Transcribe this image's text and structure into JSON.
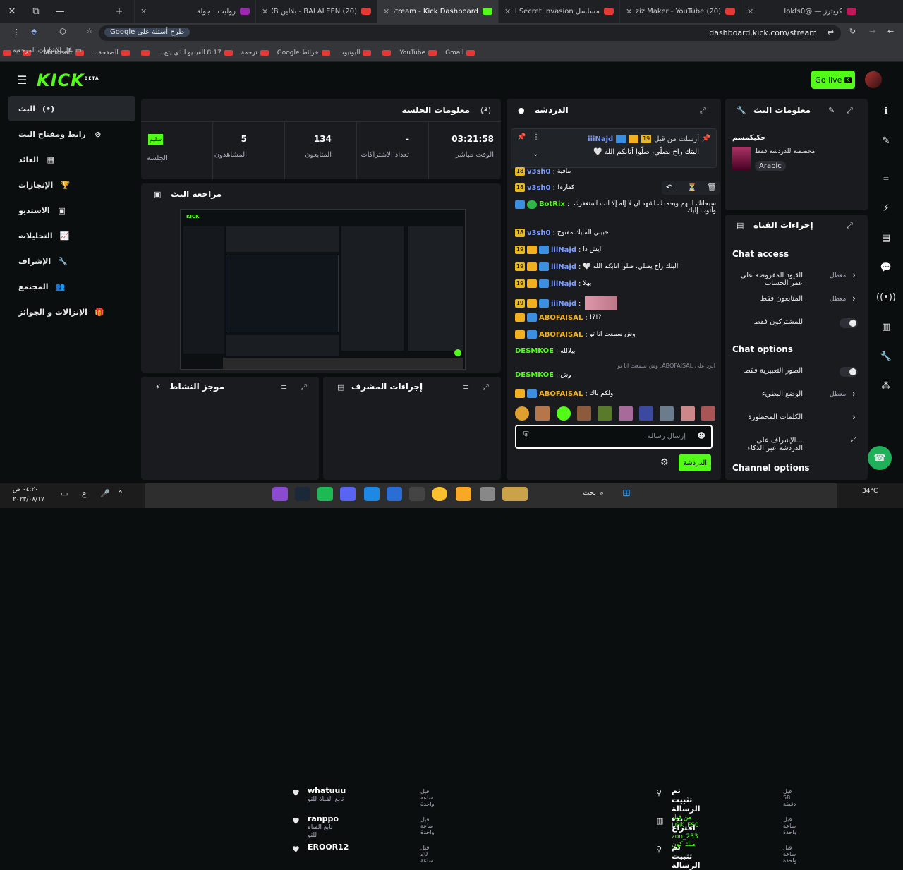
{
  "browser": {
    "tabs": [
      {
        "label": "كريترز — @lokfs0",
        "fav": "#c2185b"
      },
      {
        "label": "(20) Aziz Maker - YouTube",
        "fav": "#e53935"
      },
      {
        "label": "مسلسل Secret Invasion الموسم",
        "fav": "#e53935"
      },
      {
        "label": "Stream - Kick Dashboard",
        "fav": "#53fc18"
      },
      {
        "label": "(20) BALALEEN - بلالين BLVXB",
        "fav": "#e53935"
      },
      {
        "label": "رولیت | جولة",
        "fav": "#9c27b0"
      }
    ],
    "url": "dashboard.kick.com/stream",
    "google_chip": "طرح أسئلة على Google",
    "bookmarks": [
      "Gmail",
      "YouTube",
      "",
      "اليوتيوب",
      "خرائط Google",
      "ترجمة",
      "8:17 الفيديو الذي يتح...",
      "",
      "الصفحة...",
      "Microsoft -",
      "",
      ""
    ],
    "all_bookmarks": "كل الإشارات المرجعية"
  },
  "header": {
    "logo": "KICK",
    "logo_tag": "BETA",
    "go_live": "Go live"
  },
  "sidebar": [
    {
      "label": "البث",
      "icon": "(•)",
      "active": true
    },
    {
      "label": "رابط ومفتاح البث",
      "icon": "⊘"
    },
    {
      "label": "العائد",
      "icon": "▦"
    },
    {
      "label": "الإنجازات",
      "icon": "🏆"
    },
    {
      "label": "الاستديو",
      "icon": "▣",
      "chev": "⌄"
    },
    {
      "label": "التحليلات",
      "icon": "📈",
      "chev": "⌄"
    },
    {
      "label": "الإشراف",
      "icon": "🔧"
    },
    {
      "label": "المجتمع",
      "icon": "👥",
      "chev": "⌄"
    },
    {
      "label": "الإنزالات و الجوائز",
      "icon": "🎁"
    }
  ],
  "session": {
    "title": "معلومات الجلسة",
    "stats": [
      {
        "value": "03:21:58",
        "label": "الوقت مباشر"
      },
      {
        "value": "-",
        "label": "تعداد الاشتراكات"
      },
      {
        "value": "134",
        "label": "المتابعون"
      },
      {
        "value": "5",
        "label": "المشاهدون"
      }
    ],
    "health_badge": "سليم",
    "health_label": "الجلسة"
  },
  "preview": {
    "title": "مراجعة البث"
  },
  "activity": {
    "title": "موجز النشاط",
    "items": [
      {
        "name": "whatuuu",
        "desc": "تابع القناة للتو",
        "time": "قبل ساعة واحدة"
      },
      {
        "name": "ranppo",
        "desc": "تابع القناة للتو",
        "time": "قبل ساعة واحدة"
      },
      {
        "name": "EROOR12",
        "desc": "",
        "time": "قبل 20 ساعة"
      }
    ]
  },
  "modactions": {
    "title": "إجراءات المشرف",
    "items": [
      {
        "action": "تم تثبيت الرسالة",
        "by": "من قبل LOK_FS0",
        "time": "قبل 58 دقيقة"
      },
      {
        "action": "بدء اقتراع",
        "by": "zon_233 ملك كون",
        "time": "قبل ساعة واحدة"
      },
      {
        "action": "تم تثبيت الرسالة",
        "by": "",
        "time": "قبل ساعة واحدة"
      }
    ]
  },
  "chat": {
    "title": "الدردشة",
    "pinned": {
      "user": "iiiNajd",
      "by": "أرسلت من قبل",
      "text": "البثك راح يصلّي، صلّوا أتابكم الله 🤍"
    },
    "messages": [
      {
        "user": "v3sh0",
        "color": "#7b9bff",
        "text": "مافية",
        "badges": [
          "18"
        ]
      },
      {
        "user": "v3sh0",
        "color": "#7b9bff",
        "text": "كفارة!",
        "badges": [
          "18"
        ]
      },
      {
        "user": "BotRix",
        "color": "#53fc18",
        "text": "سبحانك اللهم وبحمدك اشهد ان لا إله إلا أنت أستغفرك وأتوب إليك",
        "badges": [
          "shield",
          "bot"
        ]
      },
      {
        "user": "v3sh0",
        "color": "#7b9bff",
        "text": "حبيبي المايك مفتوح",
        "badges": [
          "18"
        ]
      },
      {
        "user": "iiiNajd",
        "color": "#7b9bff",
        "text": "ايش ذا",
        "badges": [
          "19",
          "crown",
          "shield"
        ]
      },
      {
        "user": "iiiNajd",
        "color": "#7b9bff",
        "text": "البثك راح يصلّي، صلّوا أتابكم الله 🤍",
        "badges": [
          "19",
          "crown",
          "shield"
        ]
      },
      {
        "user": "iiiNajd",
        "color": "#7b9bff",
        "text": "يهلا",
        "badges": [
          "19",
          "crown",
          "shield"
        ]
      },
      {
        "user": "iiiNajd",
        "color": "#7b9bff",
        "text": "",
        "badges": [
          "19",
          "crown",
          "shield"
        ]
      },
      {
        "user": "ABOFAISAL",
        "color": "#f2b01e",
        "text": "?!?!",
        "badges": [
          "crown",
          "shield"
        ]
      },
      {
        "user": "ABOFAISAL",
        "color": "#f2b01e",
        "text": "وش سمعت انا تو",
        "badges": [
          "crown",
          "shield"
        ]
      },
      {
        "user": "DESMKOE",
        "color": "#53fc18",
        "text": "بيلالله",
        "badges": []
      },
      {
        "user": "DESMKOE",
        "color": "#53fc18",
        "text": "وش",
        "badges": []
      },
      {
        "user": "ABOFAISAL",
        "color": "#f2b01e",
        "text": "ولكم باك",
        "badges": [
          "crown",
          "shield"
        ]
      }
    ],
    "reply_hint": "الرد على ABOFAISAL: وش سمعت انا تو",
    "input_placeholder": "إرسال رسالة",
    "send_label": "الدردشة"
  },
  "streaminfo": {
    "title": "معلومات البث",
    "stream_title": "حكيكمسم",
    "category": "مخصصة للدردشة فقط",
    "language": "Arabic"
  },
  "channelactions": {
    "title": "إجراءات القناة",
    "chat_access": "Chat access",
    "rows_access": [
      {
        "label": "القيود المفروضة على عمر الحساب",
        "tag": "معطل",
        "kind": "chev"
      },
      {
        "label": "المتابعون فقط",
        "tag": "معطل",
        "kind": "chev"
      },
      {
        "label": "للمشتركون فقط",
        "tag": "",
        "kind": "toggle"
      }
    ],
    "chat_options": "Chat options",
    "rows_options": [
      {
        "label": "الصور التعبيرية فقط",
        "tag": "",
        "kind": "toggle"
      },
      {
        "label": "الوضع البطيء",
        "tag": "معطل",
        "kind": "chev"
      },
      {
        "label": "الكلمات المحظورة",
        "tag": "",
        "kind": "chev"
      },
      {
        "label": "...الإشراف على الدردشة عبر الذكاء",
        "tag": "",
        "kind": "ext"
      }
    ],
    "channel_options": "Channel options"
  },
  "taskbar": {
    "time": "٠٤:٢٠ ص",
    "date": "٢٠٢٣/٠٨/١٧",
    "search": "بحث",
    "lang": "ع",
    "weather": "34°C"
  }
}
